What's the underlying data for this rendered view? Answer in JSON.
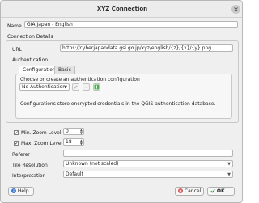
{
  "window": {
    "title": "XYZ Connection",
    "close_symbol": "×"
  },
  "form": {
    "name_label": "Name",
    "name_value": "GIA Japan - English",
    "connection_details_label": "Connection Details",
    "url_label": "URL",
    "url_value": "https://cyberjapandata.gsi.go.jp/xyz/english/{z}/{x}/{y}.png",
    "authentication_label": "Authentication",
    "tabs": [
      {
        "label": "Configurations",
        "active": true
      },
      {
        "label": "Basic",
        "active": false
      }
    ],
    "auth_prompt": "Choose or create an authentication configuration",
    "auth_select_value": "No Authentication",
    "auth_note": "Configurations store encrypted credentials in the QGIS authentication database.",
    "min_zoom_label": "Min. Zoom Level",
    "min_zoom_value": "0",
    "min_zoom_checked": true,
    "max_zoom_label": "Max. Zoom Level",
    "max_zoom_value": "18",
    "max_zoom_checked": true,
    "referer_label": "Referer",
    "referer_value": "",
    "tile_resolution_label": "Tile Resolution",
    "tile_resolution_value": "Unknown (not scaled)",
    "interpretation_label": "Interpretation",
    "interpretation_value": "Default"
  },
  "buttons": {
    "help": "Help",
    "cancel": "Cancel",
    "ok": "OK"
  },
  "icons": {
    "edit": "pencil-icon",
    "clear": "clear-icon",
    "add": "add-icon",
    "help": "help-icon",
    "cancel": "cancel-icon",
    "ok": "ok-icon"
  },
  "colors": {
    "accent_green": "#4caf50",
    "help_blue": "#3a79d0",
    "cancel_red": "#d9534f"
  }
}
